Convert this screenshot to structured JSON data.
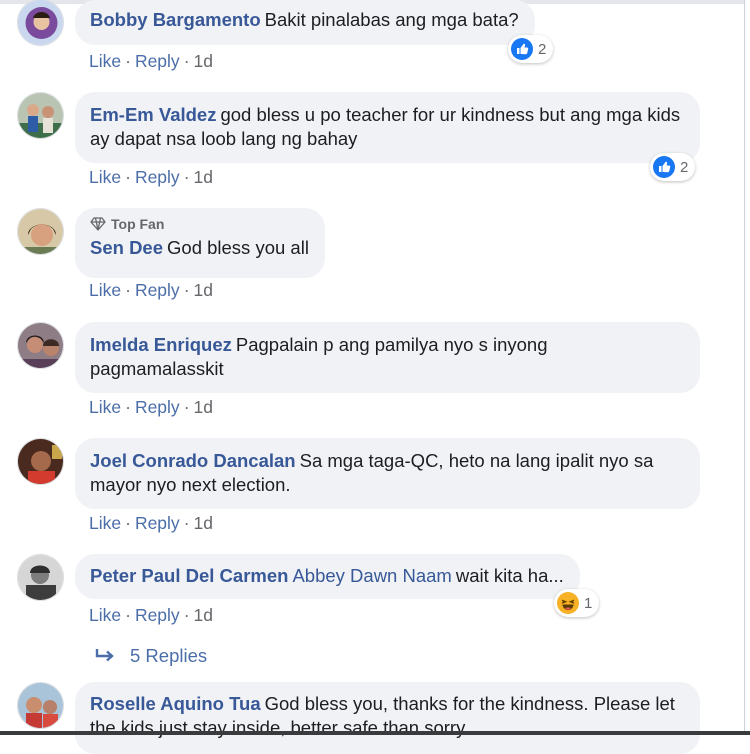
{
  "comments": [
    {
      "author": "Bobby Bargamento",
      "text": "Bakit pinalabas ang mga bata?",
      "actions": {
        "like": "Like",
        "reply": "Reply",
        "time": "1d"
      },
      "reaction": {
        "icon": "like-reaction-icon",
        "count": "2"
      }
    },
    {
      "author": "Em-Em Valdez",
      "text": "god bless u po teacher for ur kindness but ang mga kids ay dapat nsa loob lang ng bahay",
      "actions": {
        "like": "Like",
        "reply": "Reply",
        "time": "1d"
      },
      "reaction": {
        "icon": "like-reaction-icon",
        "count": "2"
      }
    },
    {
      "badge": "Top Fan",
      "author": "Sen Dee",
      "text": "God bless you all",
      "actions": {
        "like": "Like",
        "reply": "Reply",
        "time": "1d"
      }
    },
    {
      "author": "Imelda Enriquez",
      "text": "Pagpalain p ang pamilya nyo s inyong pagmamalasskit",
      "actions": {
        "like": "Like",
        "reply": "Reply",
        "time": "1d"
      }
    },
    {
      "author": "Joel Conrado Dancalan",
      "text": "Sa mga taga-QC, heto na lang ipalit nyo sa mayor nyo next election.",
      "actions": {
        "like": "Like",
        "reply": "Reply",
        "time": "1d"
      }
    },
    {
      "author": "Peter Paul Del Carmen",
      "mention": "Abbey Dawn Naam",
      "text": "wait kita ha...",
      "actions": {
        "like": "Like",
        "reply": "Reply",
        "time": "1d"
      },
      "reaction": {
        "icon": "haha-reaction-icon",
        "count": "1"
      }
    },
    {
      "author": "Roselle Aquino Tua",
      "text": "God bless you, thanks for the kindness. Please let the kids just stay inside, better safe than sorry."
    }
  ],
  "replies_link": {
    "icon": "reply-arrow-icon",
    "label": "5 Replies"
  },
  "colors": {
    "link": "#385898",
    "action": "#4b6ea9",
    "bubble": "#f0f2f5",
    "muted": "#65676b",
    "like_blue": "#1877f2",
    "haha_yellow": "#f7b125"
  }
}
